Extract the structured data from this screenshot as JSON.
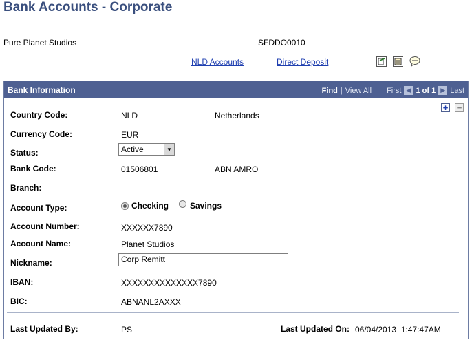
{
  "page": {
    "title": "Bank Accounts - Corporate"
  },
  "header": {
    "company_name": "Pure Planet Studios",
    "company_id": "SFDDO0010",
    "links": {
      "nld_accounts": "NLD Accounts",
      "direct_deposit": "Direct Deposit"
    },
    "toolbar_icons": [
      "notepad-edit-icon",
      "worksheet-icon",
      "comment-bubble-icon"
    ]
  },
  "panel": {
    "title": "Bank Information",
    "nav": {
      "find": "Find",
      "separator": "|",
      "view_all": "View All",
      "first": "First",
      "position": "1 of 1",
      "last": "Last"
    }
  },
  "fields": {
    "country_code": {
      "label": "Country Code:",
      "value": "NLD",
      "description": "Netherlands"
    },
    "currency_code": {
      "label": "Currency Code:",
      "value": "EUR"
    },
    "status": {
      "label": "Status:",
      "value": "Active"
    },
    "bank_code": {
      "label": "Bank Code:",
      "value": "01506801",
      "description": "ABN AMRO"
    },
    "branch": {
      "label": "Branch:"
    },
    "account_type": {
      "label": "Account Type:",
      "options": [
        "Checking",
        "Savings"
      ],
      "selected": "Checking"
    },
    "account_number": {
      "label": "Account Number:",
      "value": "XXXXXX7890"
    },
    "account_name": {
      "label": "Account Name:",
      "value": "Planet Studios"
    },
    "nickname": {
      "label": "Nickname:",
      "value": "Corp Remitt"
    },
    "iban": {
      "label": "IBAN:",
      "value": "XXXXXXXXXXXXXX7890"
    },
    "bic": {
      "label": "BIC:",
      "value": "ABNANL2AXXX"
    }
  },
  "footer": {
    "last_updated_by_label": "Last Updated By:",
    "last_updated_by": "PS",
    "last_updated_on_label": "Last Updated On:",
    "last_updated_on": "06/04/2013  1:47:47AM"
  },
  "colors": {
    "title": "#3a4f7e",
    "panel_bar": "#4e6092",
    "link": "#1f3fb0"
  }
}
